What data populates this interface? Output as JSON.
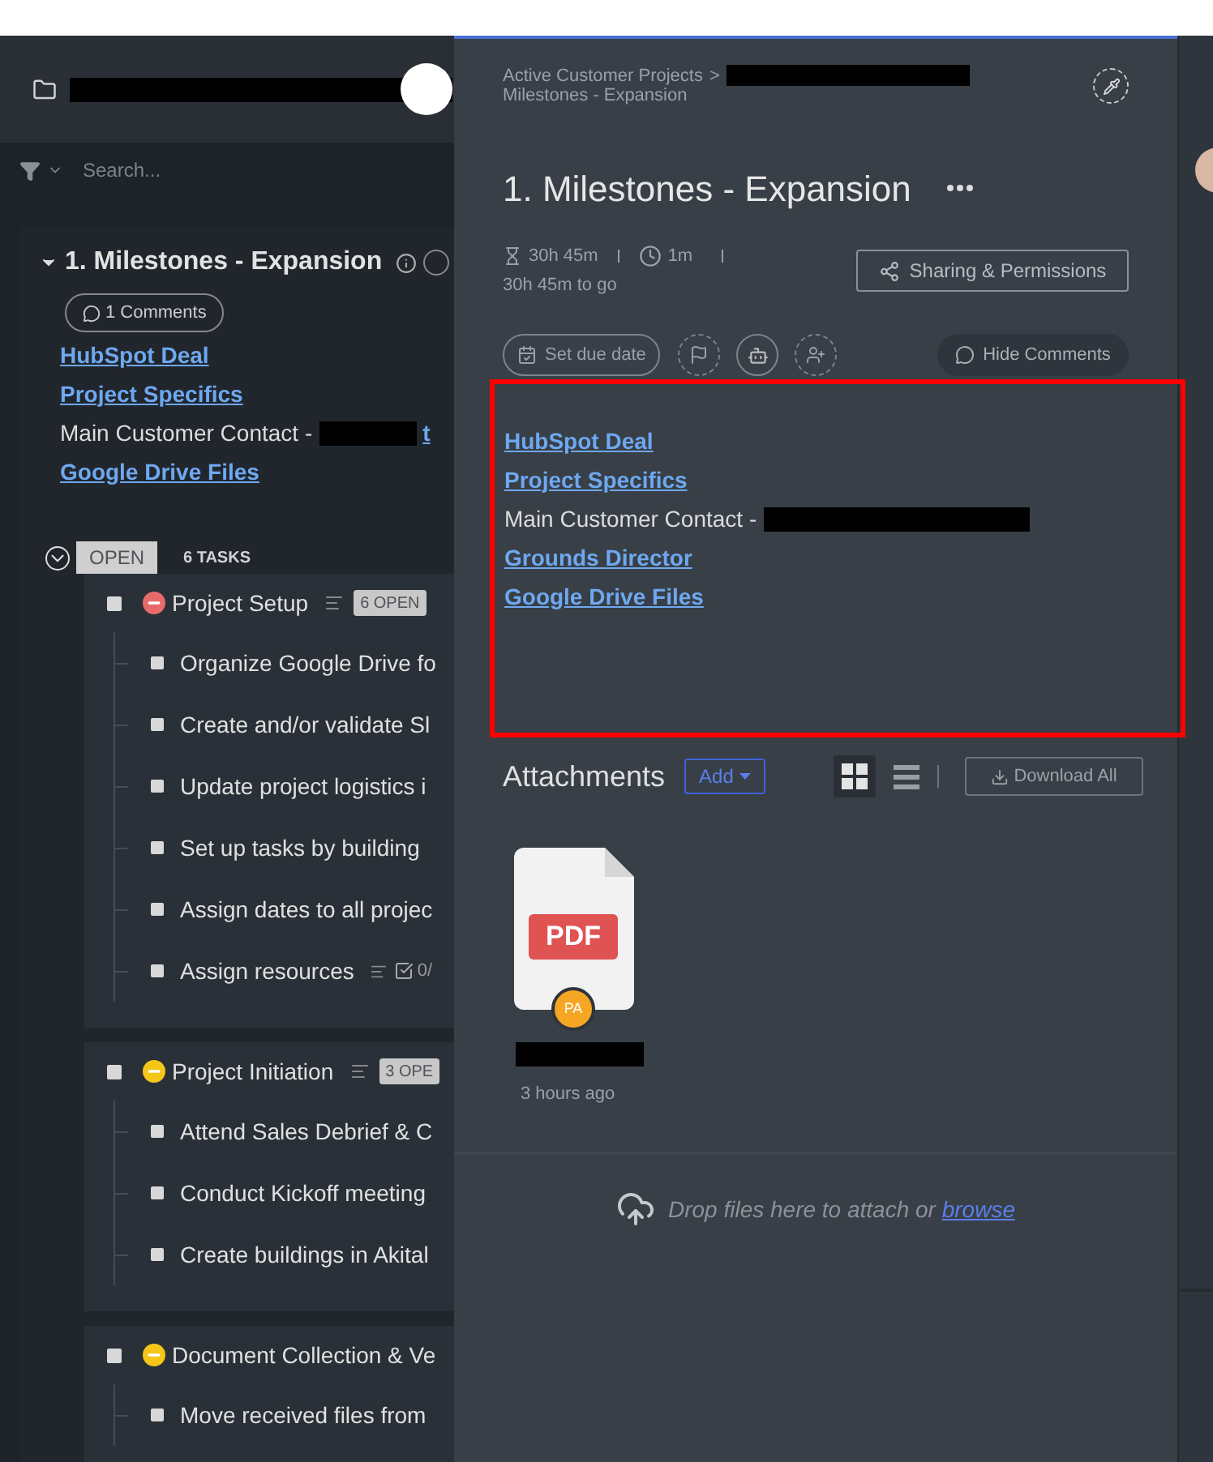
{
  "sidebar": {
    "search": {
      "placeholder": "Search..."
    },
    "list": {
      "title": "1. Milestones - Expansion",
      "comments": "1 Comments",
      "description": [
        {
          "kind": "link",
          "text": "HubSpot Deal"
        },
        {
          "kind": "link",
          "text": "Project Specifics"
        },
        {
          "kind": "contact",
          "text": "Main Customer Contact -",
          "link": "t"
        },
        {
          "kind": "link",
          "text": "Google Drive Files"
        }
      ],
      "status": "OPEN",
      "task_count": "6 TASKS",
      "groups": [
        {
          "name": "Project Setup",
          "checked": false,
          "color": "#e86a6a",
          "badge": "6 OPEN",
          "tasks": [
            {
              "name": "Organize Google Drive fo",
              "checked": false
            },
            {
              "name": "Create and/or validate Sl",
              "checked": false
            },
            {
              "name": "Update project logistics i",
              "checked": false
            },
            {
              "name": "Set up tasks by building",
              "checked": false
            },
            {
              "name": "Assign dates to all projec",
              "checked": false
            },
            {
              "name": "Assign resources",
              "checked": false,
              "checklist": "0/"
            }
          ]
        },
        {
          "name": "Project Initiation",
          "checked": false,
          "color": "#f5c518",
          "badge": "3 OPE",
          "tasks": [
            {
              "name": "Attend Sales Debrief & C",
              "checked": false
            },
            {
              "name": "Conduct Kickoff meeting",
              "checked": false
            },
            {
              "name": "Create buildings in Akital",
              "checked": false
            }
          ]
        },
        {
          "name": "Document Collection & Ve",
          "checked": false,
          "color": "#f5c518",
          "tasks": [
            {
              "name": "Move received files from",
              "checked": false
            }
          ]
        }
      ]
    }
  },
  "detail": {
    "breadcrumb": {
      "parent": "Active Customer Projects",
      "separator": ">",
      "current": "Milestones - Expansion"
    },
    "title": "1. Milestones - Expansion",
    "time_estimate": "30h 45m",
    "time_tracked": "1m",
    "time_remaining": "30h 45m to go",
    "sharing_button": "Sharing & Permissions",
    "due_date_button": "Set due date",
    "comments_button": "Hide Comments",
    "description": [
      {
        "kind": "link",
        "text": "HubSpot Deal"
      },
      {
        "kind": "link",
        "text": "Project Specifics"
      },
      {
        "kind": "contact",
        "text": "Main Customer Contact -"
      },
      {
        "kind": "link",
        "text": "Grounds Director"
      },
      {
        "kind": "link",
        "text": "Google Drive Files"
      }
    ],
    "attachments": {
      "title": "Attachments",
      "add_button": "Add",
      "views": [
        {
          "kind": "grid",
          "selected": true
        },
        {
          "kind": "list",
          "selected": false
        }
      ],
      "download_button": "Download All",
      "files": [
        {
          "type": "PDF",
          "uploader": "PA",
          "time": "3 hours ago"
        }
      ]
    },
    "dropzone": {
      "text": "Drop files here to attach or",
      "link": "browse"
    }
  }
}
